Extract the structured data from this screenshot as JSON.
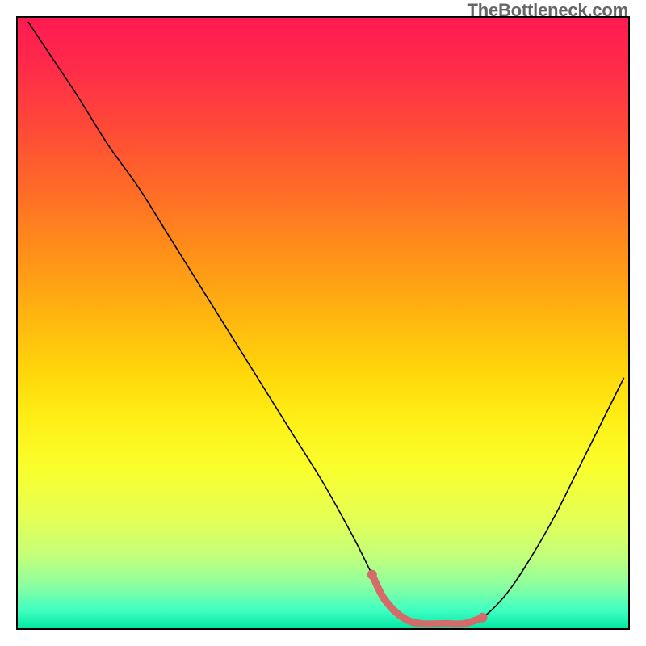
{
  "watermark": "TheBottleneck.com",
  "chart_data": {
    "type": "line",
    "title": "",
    "xlabel": "",
    "ylabel": "",
    "xlim": [
      0,
      100
    ],
    "ylim": [
      0,
      100
    ],
    "series": [
      {
        "name": "bottleneck-curve",
        "x": [
          2,
          6,
          10,
          15,
          20,
          25,
          30,
          35,
          40,
          45,
          50,
          55,
          58,
          60,
          63,
          66,
          70,
          73,
          76,
          80,
          84,
          88,
          92,
          96,
          99
        ],
        "y": [
          99,
          93,
          87,
          79,
          72,
          64,
          56,
          48,
          40,
          32,
          24,
          15,
          9,
          5,
          2,
          1,
          1,
          1,
          2,
          6,
          12,
          19,
          27,
          35,
          41
        ],
        "stroke": "#000000",
        "stroke_width": 1.6
      },
      {
        "name": "highlight-band",
        "x": [
          58,
          60,
          63,
          66,
          70,
          73,
          76
        ],
        "y": [
          9,
          5,
          2,
          1,
          1,
          1,
          2
        ],
        "stroke": "#d46a6a",
        "stroke_width": 9,
        "dots_x": [
          58,
          76
        ],
        "dots_y": [
          9,
          2
        ],
        "dot_r": 6
      }
    ],
    "background_gradient": {
      "stops": [
        {
          "offset": 0.0,
          "color": "#ff1a52"
        },
        {
          "offset": 0.08,
          "color": "#ff2a4a"
        },
        {
          "offset": 0.18,
          "color": "#ff4938"
        },
        {
          "offset": 0.28,
          "color": "#ff6a28"
        },
        {
          "offset": 0.38,
          "color": "#ff8e1a"
        },
        {
          "offset": 0.48,
          "color": "#ffb210"
        },
        {
          "offset": 0.58,
          "color": "#ffd60a"
        },
        {
          "offset": 0.66,
          "color": "#fff017"
        },
        {
          "offset": 0.74,
          "color": "#f9ff2e"
        },
        {
          "offset": 0.82,
          "color": "#e4ff55"
        },
        {
          "offset": 0.88,
          "color": "#c4ff7a"
        },
        {
          "offset": 0.93,
          "color": "#8affa0"
        },
        {
          "offset": 0.97,
          "color": "#3effc2"
        },
        {
          "offset": 1.0,
          "color": "#00e6a1"
        }
      ]
    },
    "frame_stroke": "#000000",
    "frame_stroke_width": 2
  }
}
